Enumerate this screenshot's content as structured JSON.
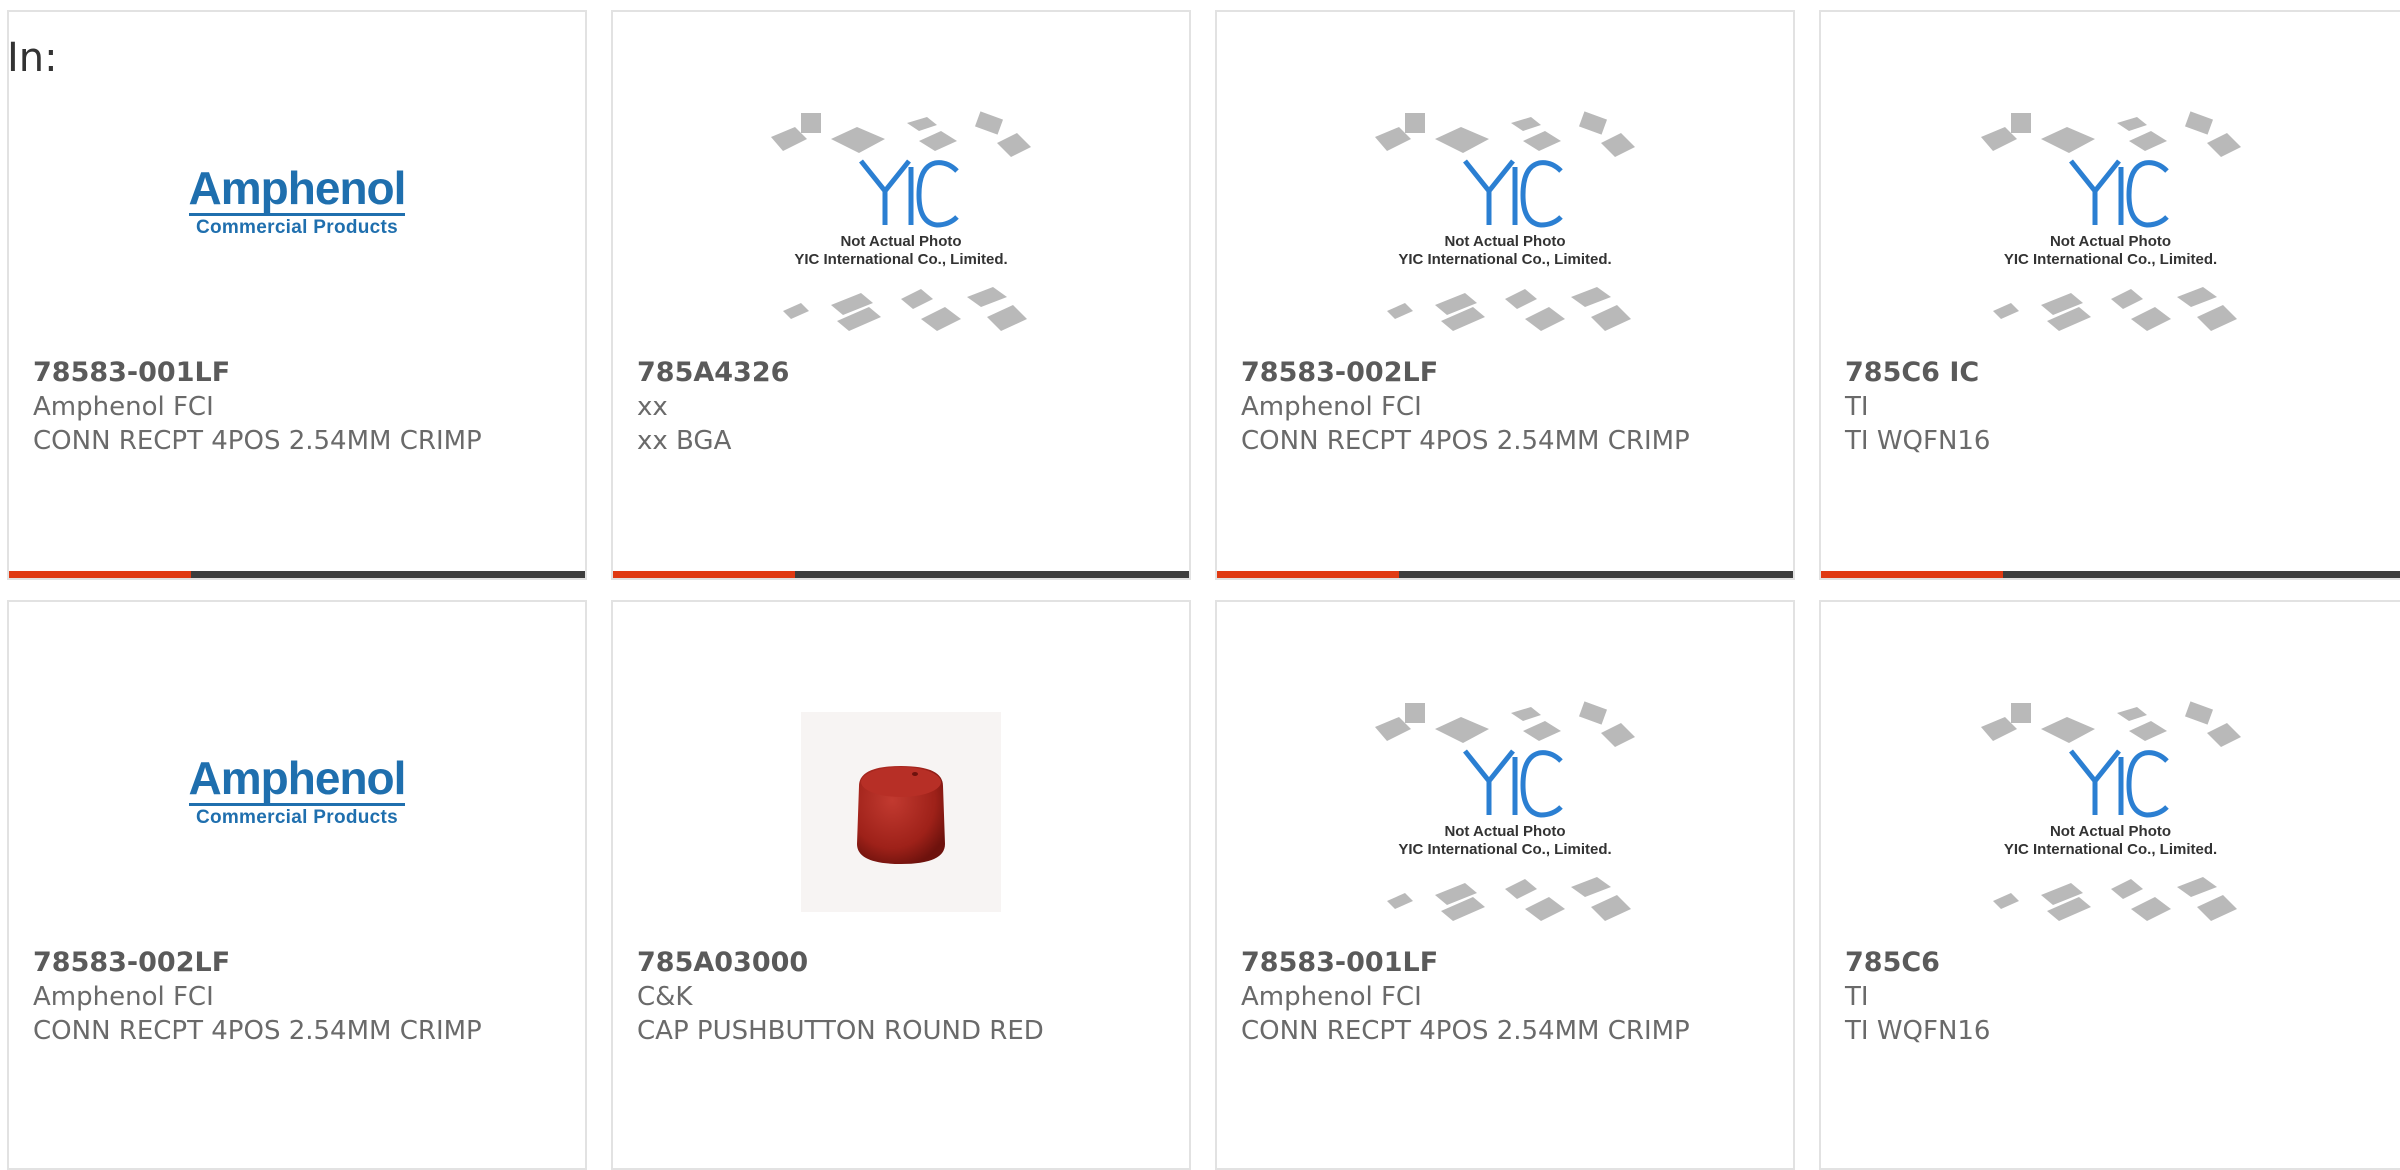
{
  "header": {
    "in_label": "In:"
  },
  "products": [
    {
      "part_number": "78583-001LF",
      "manufacturer": "Amphenol FCI",
      "description": "CONN RECPT 4POS 2.54MM CRIMP",
      "image": "amphenol-logo"
    },
    {
      "part_number": "785A4326",
      "manufacturer": "xx",
      "description": "xx BGA",
      "image": "not-actual-photo"
    },
    {
      "part_number": "78583-002LF",
      "manufacturer": "Amphenol FCI",
      "description": "CONN RECPT 4POS 2.54MM CRIMP",
      "image": "not-actual-photo"
    },
    {
      "part_number": "785C6 IC",
      "manufacturer": "TI",
      "description": "TI WQFN16",
      "image": "not-actual-photo"
    },
    {
      "part_number": "78583-002LF",
      "manufacturer": "Amphenol FCI",
      "description": "CONN RECPT 4POS 2.54MM CRIMP",
      "image": "amphenol-logo"
    },
    {
      "part_number": "785A03000",
      "manufacturer": "C&K",
      "description": "CAP PUSHBUTTON ROUND RED",
      "image": "red-cap-photo"
    },
    {
      "part_number": "78583-001LF",
      "manufacturer": "Amphenol FCI",
      "description": "CONN RECPT 4POS 2.54MM CRIMP",
      "image": "not-actual-photo"
    },
    {
      "part_number": "785C6",
      "manufacturer": "TI",
      "description": "TI WQFN16",
      "image": "not-actual-photo"
    }
  ],
  "logos": {
    "amphenol_main": "Amphenol",
    "amphenol_sub": "Commercial Products"
  },
  "placeholder": {
    "line1": "Not Actual Photo",
    "line2": "YIC International Co., Limited.",
    "logo_text": "YIC"
  },
  "colors": {
    "accent": "#e03a13",
    "bar_dark": "#3d3d3d",
    "brand_blue": "#1f6fae"
  }
}
